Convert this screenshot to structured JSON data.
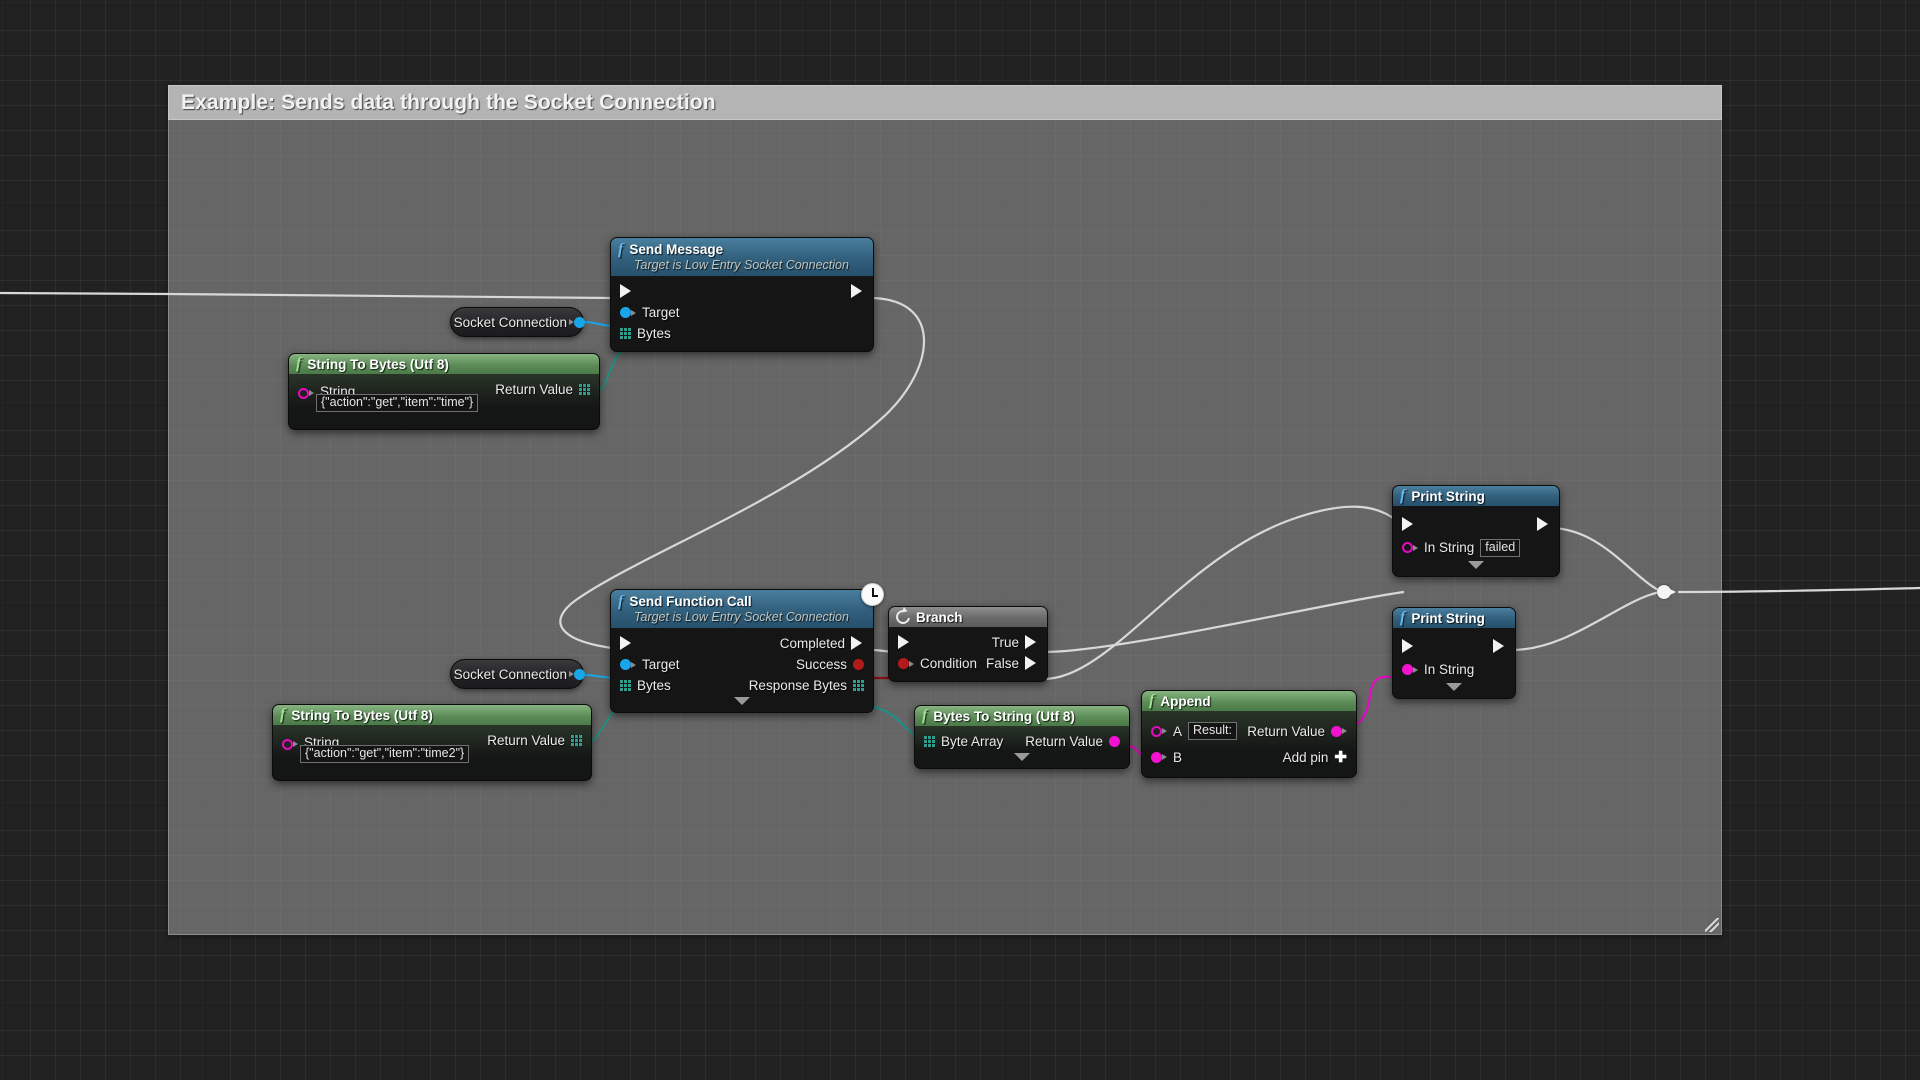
{
  "comment": {
    "title": "Example: Sends data through the Socket Connection"
  },
  "nodes": {
    "send_message": {
      "title": "Send Message",
      "subtitle": "Target is Low Entry Socket Connection",
      "inputs": {
        "target": "Target",
        "bytes": "Bytes"
      }
    },
    "string_to_bytes_1": {
      "title": "String To Bytes (Utf 8)",
      "input_label": "String",
      "input_value": "{\"action\":\"get\",\"item\":\"time\"}",
      "output_label": "Return Value"
    },
    "socket_connection_1": {
      "label": "Socket Connection"
    },
    "send_function_call": {
      "title": "Send Function Call",
      "subtitle": "Target is Low Entry Socket Connection",
      "inputs": {
        "target": "Target",
        "bytes": "Bytes"
      },
      "outputs": {
        "completed": "Completed",
        "success": "Success",
        "response_bytes": "Response Bytes"
      }
    },
    "string_to_bytes_2": {
      "title": "String To Bytes (Utf 8)",
      "input_label": "String",
      "input_value": "{\"action\":\"get\",\"item\":\"time2\"}",
      "output_label": "Return Value"
    },
    "socket_connection_2": {
      "label": "Socket Connection"
    },
    "branch": {
      "title": "Branch",
      "condition": "Condition",
      "true_label": "True",
      "false_label": "False"
    },
    "bytes_to_string": {
      "title": "Bytes To String (Utf 8)",
      "input_label": "Byte Array",
      "output_label": "Return Value"
    },
    "append": {
      "title": "Append",
      "a_label": "A",
      "a_value": "Result:",
      "b_label": "B",
      "output_label": "Return Value",
      "add_pin_label": "Add pin"
    },
    "print_string_1": {
      "title": "Print String",
      "input_label": "In String",
      "input_value": "failed"
    },
    "print_string_2": {
      "title": "Print String",
      "input_label": "In String"
    }
  },
  "colors": {
    "exec_wire": "#d8d8d8",
    "bool_wire": "#8d1010",
    "byte_array_wire": "#1f8f84",
    "string_wire": "#e50ac0",
    "object_wire": "#19a6e8",
    "header_function": "#315f7c",
    "header_pure": "#5d8c59",
    "comment_bar": "#b4b4b4"
  }
}
